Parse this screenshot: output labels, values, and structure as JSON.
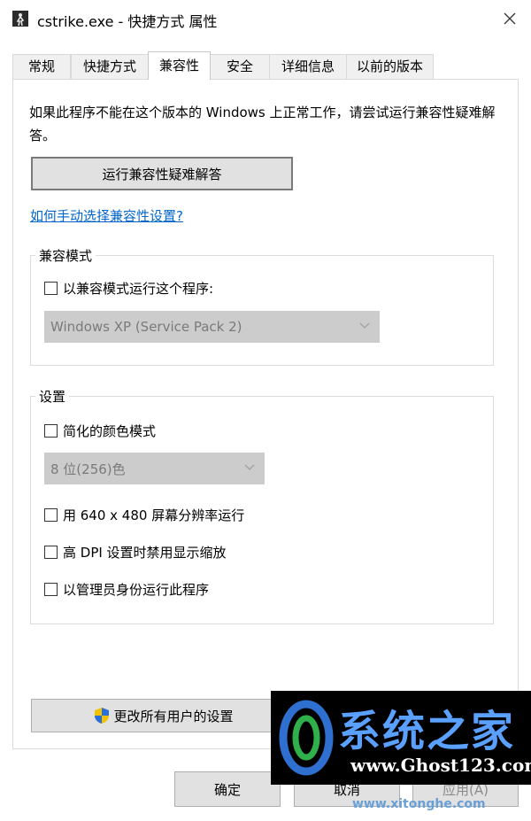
{
  "window": {
    "title": "cstrike.exe - 快捷方式 属性",
    "app_icon": "cstrike-app-icon",
    "close_icon": "close-icon"
  },
  "tabs": [
    {
      "label": "常规",
      "active": false
    },
    {
      "label": "快捷方式",
      "active": false
    },
    {
      "label": "兼容性",
      "active": true
    },
    {
      "label": "安全",
      "active": false
    },
    {
      "label": "详细信息",
      "active": false
    },
    {
      "label": "以前的版本",
      "active": false
    }
  ],
  "compat": {
    "description": "如果此程序不能在这个版本的 Windows 上正常工作，请尝试运行兼容性疑难解答。",
    "troubleshoot_button": "运行兼容性疑难解答",
    "manual_link": "如何手动选择兼容性设置?"
  },
  "compat_mode": {
    "group_title": "兼容模式",
    "checkbox_label": "以兼容模式运行这个程序:",
    "checked": false,
    "os_select_value": "Windows XP (Service Pack 2)"
  },
  "settings": {
    "group_title": "设置",
    "reduced_color_label": "简化的颜色模式",
    "reduced_color_checked": false,
    "color_select_value": "8 位(256)色",
    "res640_label": "用 640 x 480 屏幕分辨率运行",
    "res640_checked": false,
    "dpi_label": "高 DPI 设置时禁用显示缩放",
    "dpi_checked": false,
    "admin_label": "以管理员身份运行此程序",
    "admin_checked": false
  },
  "all_users_button": "更改所有用户的设置",
  "footer": {
    "ok": "确定",
    "cancel": "取消",
    "apply": "应用(A)"
  },
  "watermark": {
    "title": "系统之家",
    "url": "www.Ghost123.com",
    "url2": "www.xitonghe.com"
  },
  "colors": {
    "link": "#0066cc",
    "button_bg": "#e1e1e1",
    "disabled_select_bg": "#cccccc",
    "watermark_blue": "#5aa0ff"
  }
}
